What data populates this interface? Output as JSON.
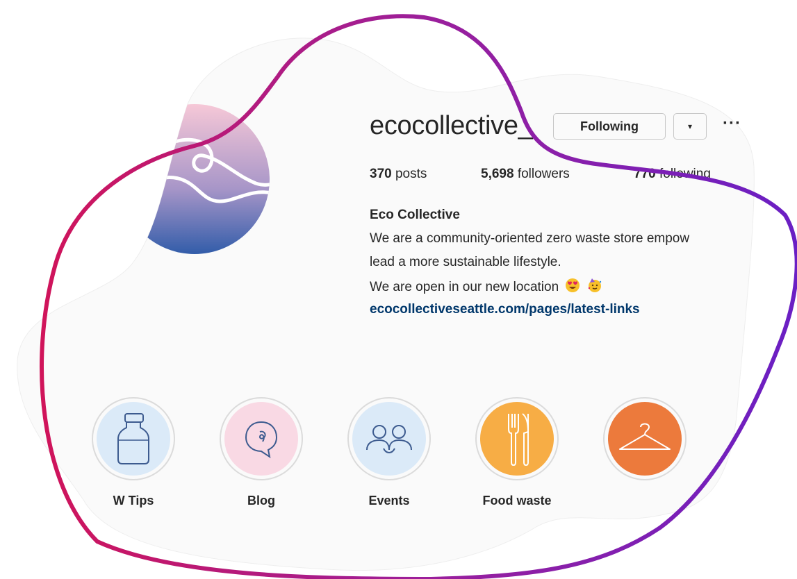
{
  "profile": {
    "username": "ecocollective_",
    "following_label": "Following",
    "dropdown_glyph": "▾",
    "more_glyph": "···",
    "stats": {
      "posts_count": "370",
      "posts_label": " posts",
      "followers_count": "5,698",
      "followers_label": " followers",
      "following_count": "770",
      "following_label": " following"
    },
    "bio": {
      "name": "Eco Collective",
      "line1": "We are a community-oriented zero waste store empow",
      "line2": "lead a more sustainable lifestyle.",
      "line3": "We are open in our new location",
      "link": "ecocollectiveseattle.com/pages/latest-links"
    },
    "avatar_icon": "wave-logo-icon"
  },
  "highlights": [
    {
      "label": "W Tips",
      "icon": "jar-icon",
      "color": "#dbeaf8"
    },
    {
      "label": "Blog",
      "icon": "speech-bubble-icon",
      "color": "#f9d9e4"
    },
    {
      "label": "Events",
      "icon": "people-icon",
      "color": "#dbeaf8"
    },
    {
      "label": "Food waste",
      "icon": "fork-knife-icon",
      "color": "#f7ad45"
    },
    {
      "label": "",
      "icon": "hanger-icon",
      "color": "#ec7a3c"
    }
  ],
  "colors": {
    "link": "#00376b",
    "blob_background": "#fafafa",
    "swoosh_start": "#d0145a",
    "swoosh_end": "#6a1fc4"
  }
}
